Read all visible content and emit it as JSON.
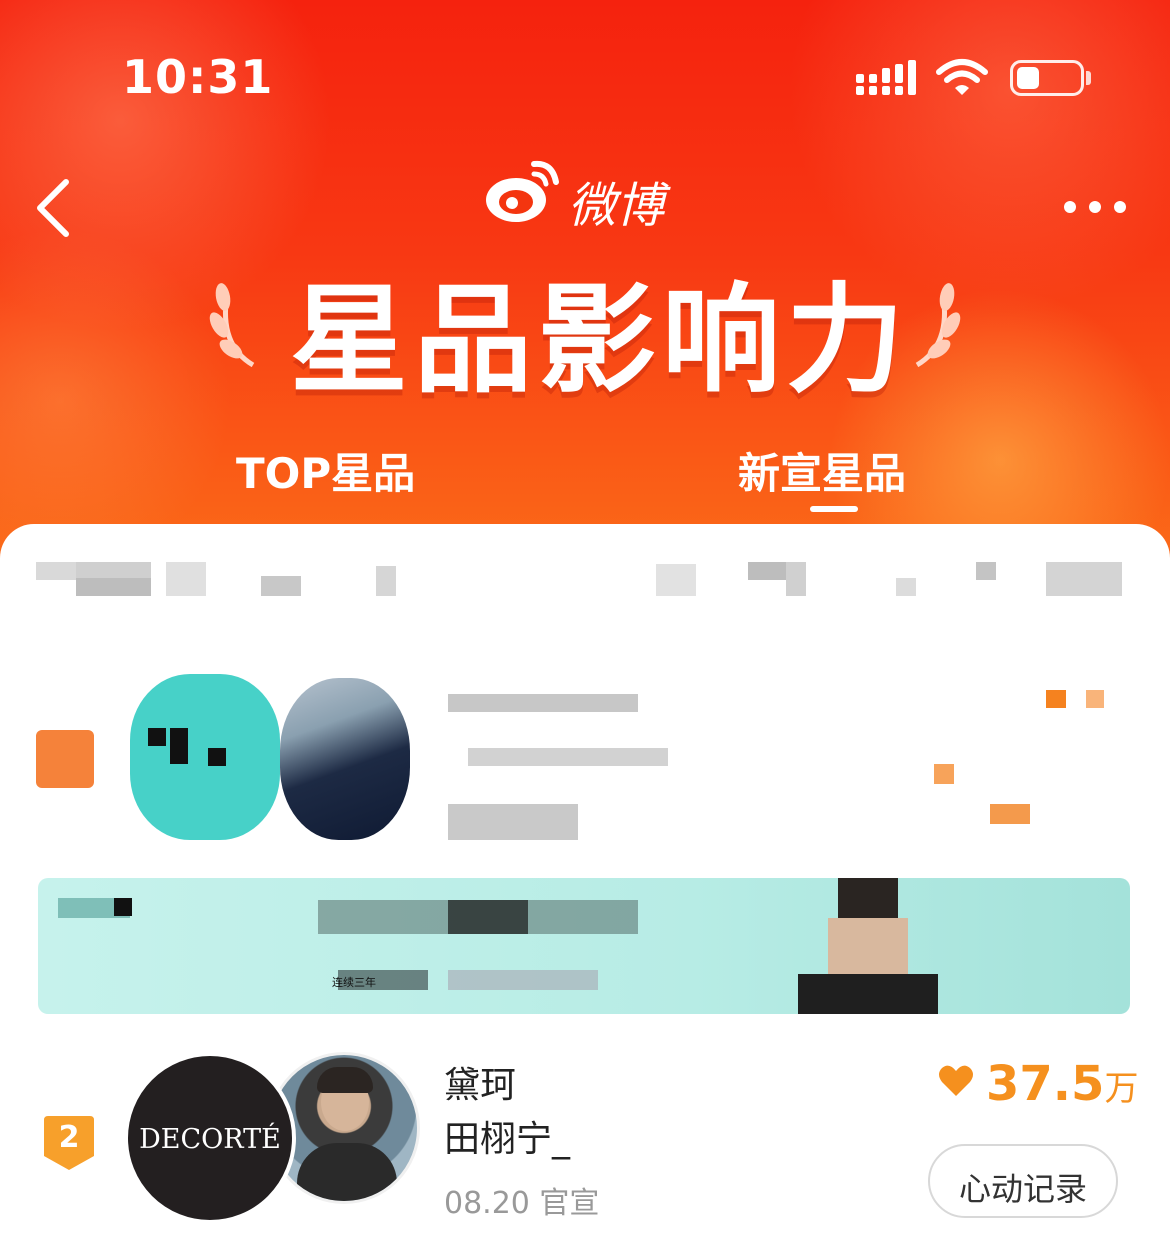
{
  "status_bar": {
    "time": "10:31"
  },
  "header": {
    "brand": "微博",
    "title": "星品影响力",
    "tabs": [
      {
        "label": "TOP星品",
        "active": false
      },
      {
        "label": "新宣星品",
        "active": true
      }
    ]
  },
  "list": {
    "banner_caption": "连续三年",
    "items": [
      {
        "rank": "2",
        "brand_avatar_text": "DECORTÉ",
        "brand": "黛珂",
        "star": "田栩宁_",
        "date_line": "08.20 官宣",
        "score": "37.5",
        "score_unit": "万",
        "record_button": "心动记录"
      }
    ]
  },
  "colors": {
    "header_red": "#f5220e",
    "header_orange": "#fb6a18",
    "score_orange": "#f5901e",
    "rank_badge": "#f7a02b",
    "banner_teal": "#b7ece5"
  },
  "icons": [
    "back-icon",
    "more-icon",
    "weibo-logo-icon",
    "heart-icon",
    "signal-icon",
    "wifi-icon",
    "battery-icon",
    "laurel-icon"
  ]
}
